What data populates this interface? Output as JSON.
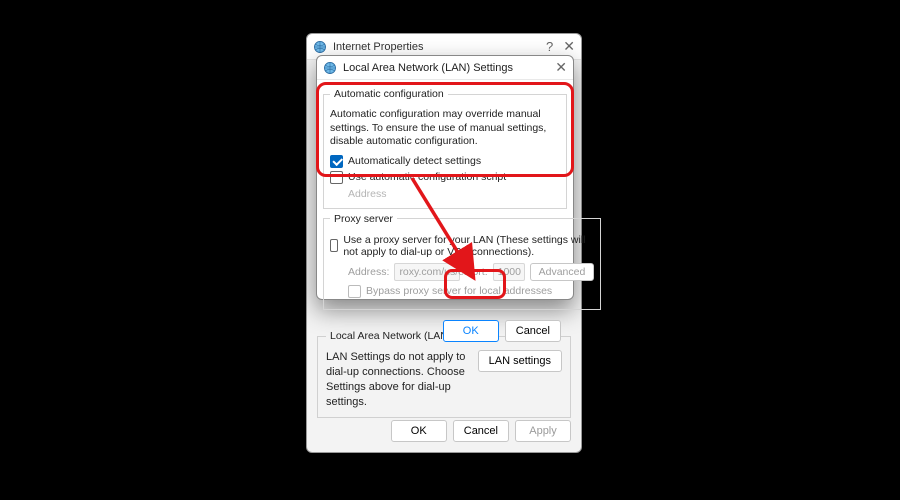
{
  "parent": {
    "title": "Internet Properties",
    "help_glyph": "?",
    "close_glyph": "✕",
    "lan_section": {
      "legend": "Local Area Network (LAN) settings",
      "text": "LAN Settings do not apply to dial-up connections. Choose Settings above for dial-up settings.",
      "button": "LAN settings"
    },
    "buttons": {
      "ok": "OK",
      "cancel": "Cancel",
      "apply": "Apply"
    }
  },
  "lan": {
    "title": "Local Area Network (LAN) Settings",
    "close_glyph": "✕",
    "auto": {
      "legend": "Automatic configuration",
      "desc": "Automatic configuration may override manual settings.  To ensure the use of manual settings, disable automatic configuration.",
      "detect_label": "Automatically detect settings",
      "script_label": "Use automatic configuration script",
      "address_label": "Address"
    },
    "proxy": {
      "legend": "Proxy server",
      "use_label": "Use a proxy server for your LAN (These settings will not apply to dial-up or VPN connections).",
      "addr_label": "Address:",
      "addr_value": "roxy.com/us/en",
      "port_label": "Port:",
      "port_value": "1000",
      "advanced": "Advanced",
      "bypass_label": "Bypass proxy server for local addresses"
    },
    "buttons": {
      "ok": "OK",
      "cancel": "Cancel"
    }
  },
  "colors": {
    "highlight": "#e2161a",
    "accent": "#0067c0"
  }
}
